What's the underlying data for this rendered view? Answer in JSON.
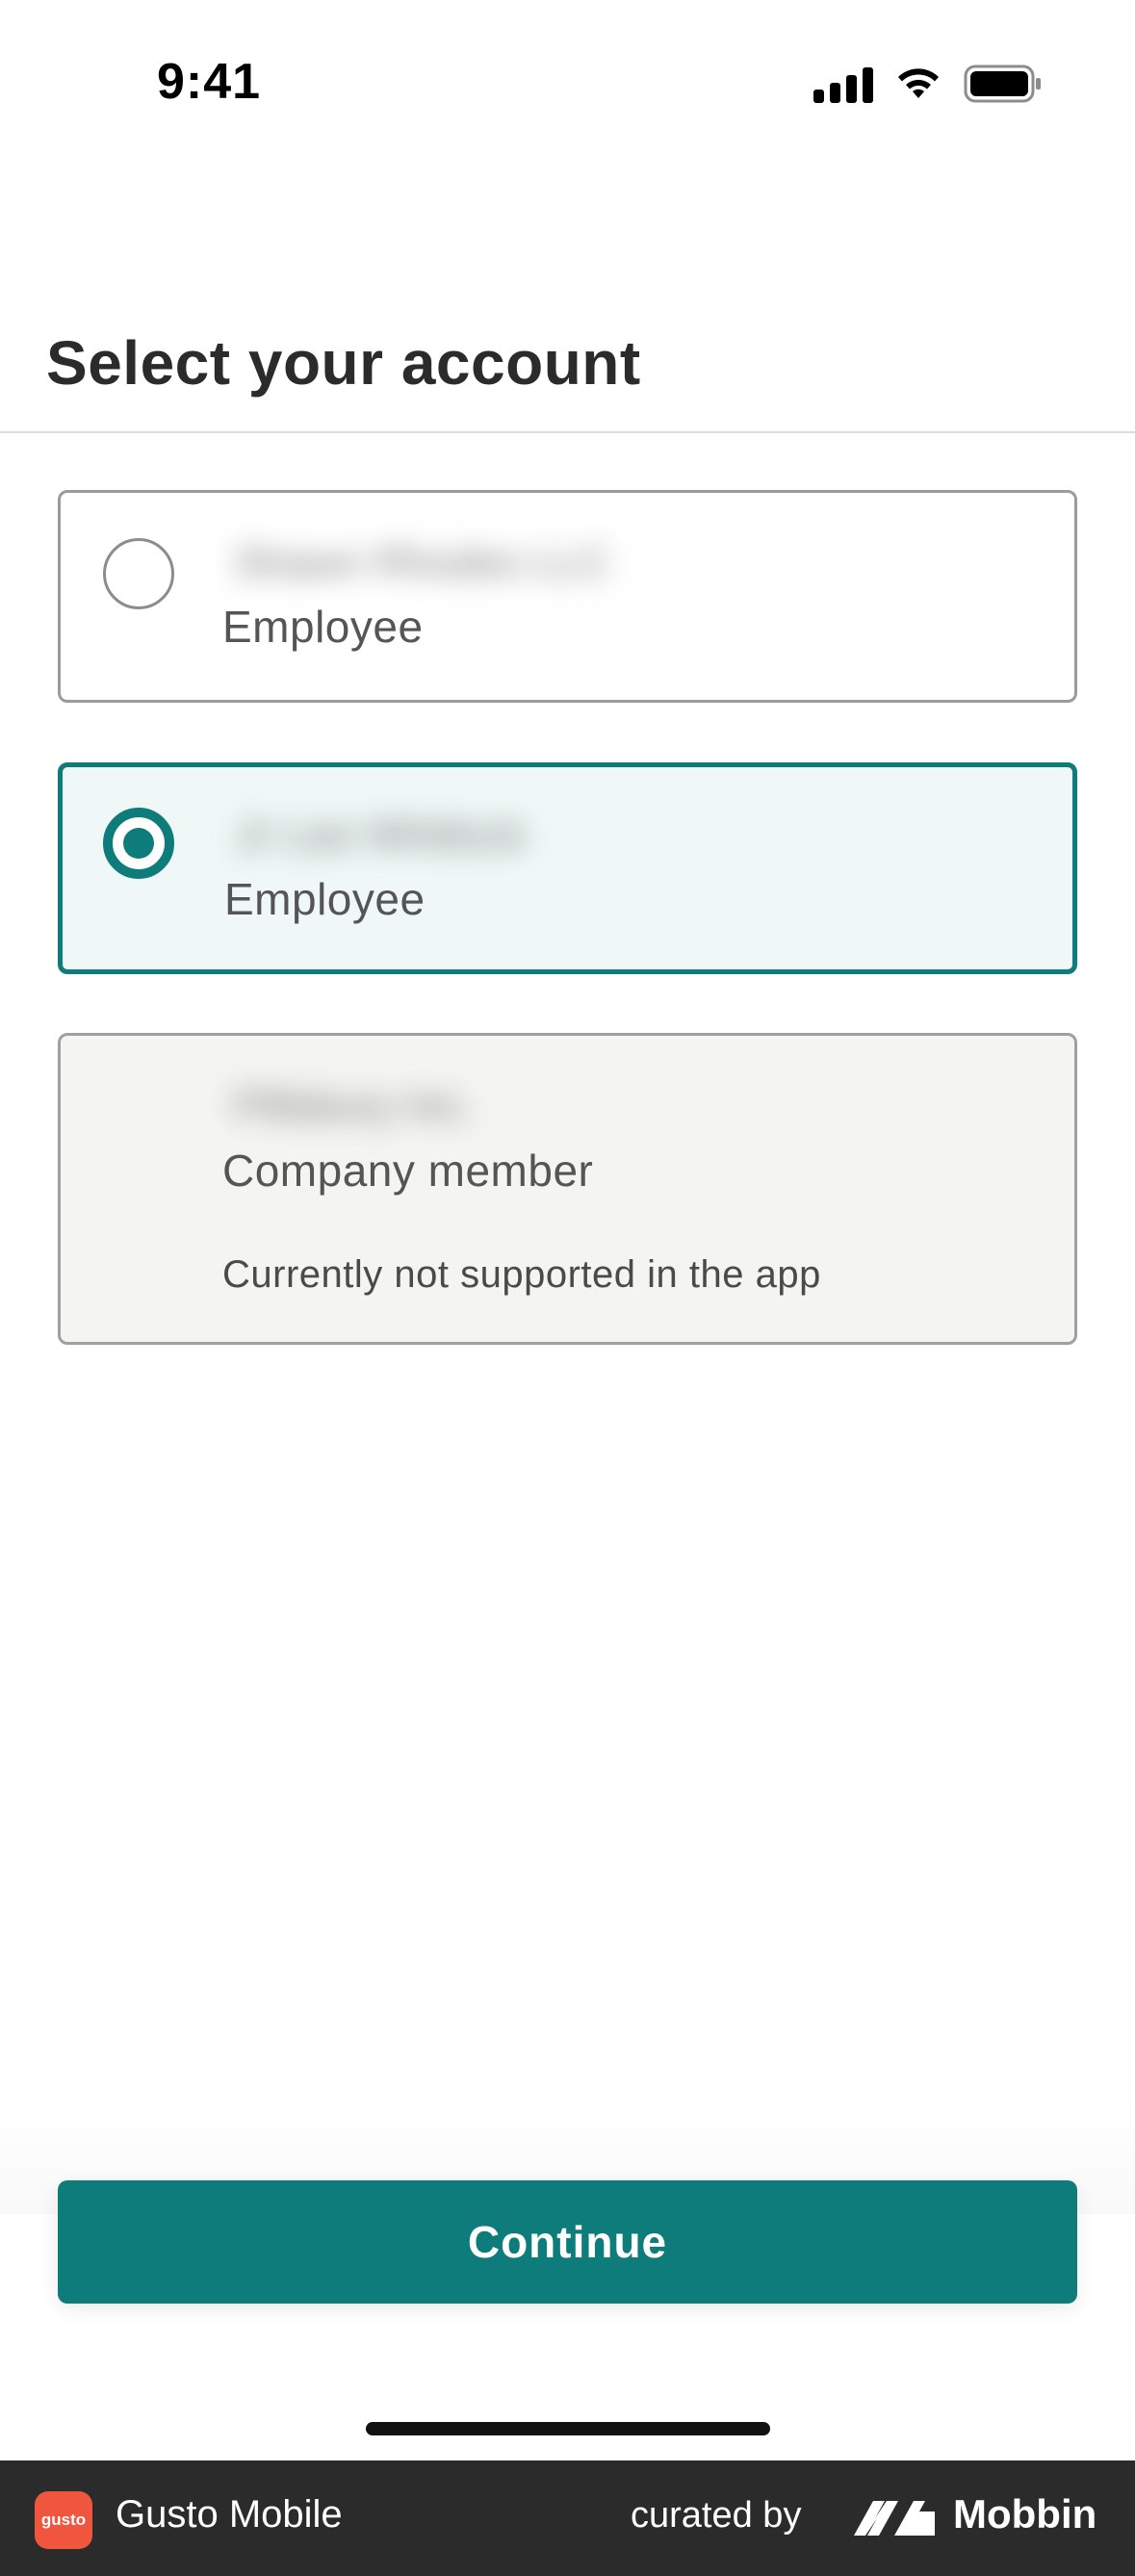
{
  "status_bar": {
    "time": "9:41",
    "icons": [
      "cellular-signal-icon",
      "wifi-icon",
      "battery-icon"
    ]
  },
  "header": {
    "title": "Select your account"
  },
  "accounts": [
    {
      "name": "Shawn Rhodes LLC",
      "role": "Employee",
      "selected": false,
      "supported": true
    },
    {
      "name": "Jr Lee Whitlock",
      "role": "Employee",
      "selected": true,
      "supported": true
    },
    {
      "name": "Pillsbury Inc.",
      "role": "Company member",
      "selected": false,
      "supported": false,
      "note": "Currently not supported in the app"
    }
  ],
  "actions": {
    "continue_label": "Continue"
  },
  "footer": {
    "app_logo_text": "gusto",
    "app_name": "Gusto Mobile",
    "curated_label": "curated by",
    "brand_name": "Mobbin"
  },
  "colors": {
    "accent": "#0d7c7a",
    "selected_bg": "#eff8f6",
    "disabled_bg": "#f4f4f1",
    "footer_bg": "#2b2b2b",
    "app_logo": "#f0563e"
  }
}
